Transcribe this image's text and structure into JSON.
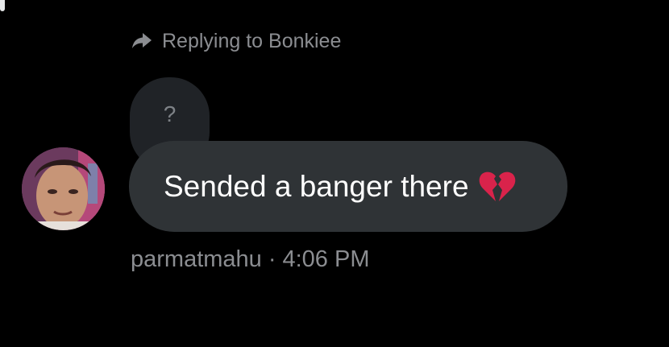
{
  "colors": {
    "background": "#000000",
    "muted_text": "#8b8d91",
    "message_bubble": "#2f3336",
    "quoted_bubble": "#202327",
    "heart": "#d9234b"
  },
  "reply_header": {
    "icon": "reply-arrow-icon",
    "text": "Replying to Bonkiee"
  },
  "quoted_message": {
    "text": "?"
  },
  "message": {
    "text": "Sended a banger there",
    "emoji_icon": "broken-heart-icon"
  },
  "sender": {
    "avatar_icon": "avatar-photo",
    "username": "parmatmahu",
    "separator": "·",
    "time": "4:06 PM"
  }
}
